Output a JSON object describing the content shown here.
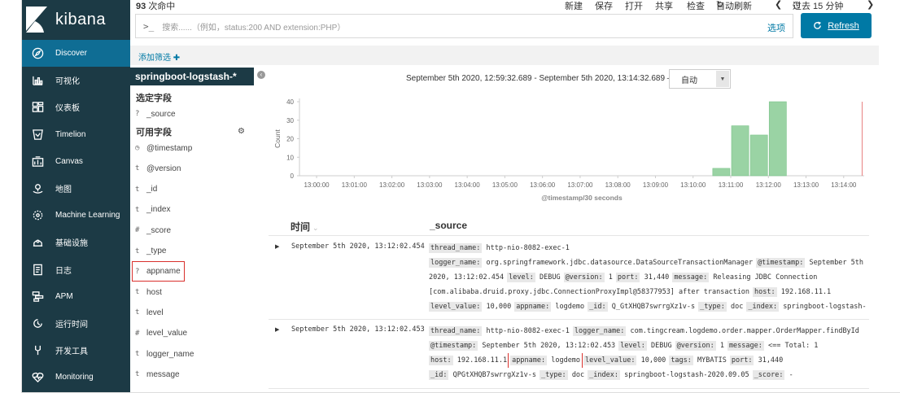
{
  "brand": {
    "name": "kibana"
  },
  "nav": {
    "items": [
      {
        "label": "Discover",
        "icon": "compass-icon",
        "active": true
      },
      {
        "label": "可视化",
        "icon": "visualize-icon"
      },
      {
        "label": "仪表板",
        "icon": "dashboard-icon"
      },
      {
        "label": "Timelion",
        "icon": "timelion-icon"
      },
      {
        "label": "Canvas",
        "icon": "canvas-icon"
      },
      {
        "label": "地图",
        "icon": "maps-icon"
      },
      {
        "label": "Machine Learning",
        "icon": "ml-icon"
      },
      {
        "label": "基础设施",
        "icon": "infra-icon"
      },
      {
        "label": "日志",
        "icon": "logs-icon"
      },
      {
        "label": "APM",
        "icon": "apm-icon"
      },
      {
        "label": "运行时间",
        "icon": "uptime-icon"
      },
      {
        "label": "开发工具",
        "icon": "devtools-icon"
      },
      {
        "label": "Monitoring",
        "icon": "monitoring-icon"
      }
    ]
  },
  "topbar": {
    "hits_count": "93",
    "hits_suffix": "次命中",
    "menu": {
      "new": "新建",
      "save": "保存",
      "open": "打开",
      "share": "共享",
      "inspect": "检查",
      "auto_refresh": "自动刷新",
      "time_range": "过去 15 分钟"
    },
    "search": {
      "prompt": ">_",
      "placeholder": "搜索......（例如，status:200 AND extension:PHP）",
      "options": "选项"
    },
    "refresh": "Refresh",
    "add_filter": "添加筛选"
  },
  "sidebar": {
    "index_pattern": "springboot-logstash-*",
    "selected_title": "选定字段",
    "selected_fields": [
      {
        "type": "?",
        "name": "_source"
      }
    ],
    "available_title": "可用字段",
    "available_fields": [
      {
        "type": "clock",
        "name": "@timestamp"
      },
      {
        "type": "t",
        "name": "@version"
      },
      {
        "type": "t",
        "name": "_id"
      },
      {
        "type": "t",
        "name": "_index"
      },
      {
        "type": "#",
        "name": "_score"
      },
      {
        "type": "t",
        "name": "_type"
      },
      {
        "type": "?",
        "name": "appname",
        "highlighted": true
      },
      {
        "type": "t",
        "name": "host"
      },
      {
        "type": "t",
        "name": "level"
      },
      {
        "type": "#",
        "name": "level_value"
      },
      {
        "type": "t",
        "name": "logger_name"
      },
      {
        "type": "t",
        "name": "message"
      }
    ]
  },
  "histogram": {
    "time_range_label": "September 5th 2020, 12:59:32.689 - September 5th 2020, 13:14:32.689 —",
    "interval": "自动"
  },
  "chart_data": {
    "type": "bar",
    "xlabel": "@timestamp/30 seconds",
    "ylabel": "Count",
    "ylim": [
      0,
      40
    ],
    "yticks": [
      0,
      10,
      20,
      30,
      40
    ],
    "xticks": [
      "13:00:00",
      "13:01:00",
      "13:02:00",
      "13:03:00",
      "13:04:00",
      "13:05:00",
      "13:06:00",
      "13:07:00",
      "13:08:00",
      "13:09:00",
      "13:10:00",
      "13:11:00",
      "13:12:00",
      "13:13:00",
      "13:14:00"
    ],
    "bars": [
      {
        "x": "13:10:30",
        "value": 4
      },
      {
        "x": "13:11:00",
        "value": 27
      },
      {
        "x": "13:11:30",
        "value": 22
      },
      {
        "x": "13:12:00",
        "value": 40
      }
    ],
    "bar_color": "#9ad3a4",
    "now_line": "13:14:32"
  },
  "table": {
    "col_time": "时间",
    "col_source": "_source",
    "rows": [
      {
        "time": "September 5th 2020, 13:12:02.454",
        "lines": [
          [
            [
              "thread_name:",
              "http-nio-8082-exec-1"
            ]
          ],
          [
            [
              "logger_name:",
              "org.springframework.jdbc.datasource.DataSourceTransactionManager"
            ],
            [
              "@timestamp:",
              "September 5th"
            ]
          ],
          [
            [
              "",
              "2020, 13:12:02.454"
            ],
            [
              "level:",
              "DEBUG"
            ],
            [
              "@version:",
              "1"
            ],
            [
              "port:",
              "31,440"
            ],
            [
              "message:",
              "Releasing JDBC Connection"
            ]
          ],
          [
            [
              "",
              "[com.alibaba.druid.proxy.jdbc.ConnectionProxyImpl@58377953] after transaction"
            ],
            [
              "host:",
              "192.168.11.1"
            ]
          ],
          [
            [
              "level_value:",
              "10,000"
            ],
            [
              "appname:",
              "logdemo"
            ],
            [
              "_id:",
              "Q_GtXHQB7swrrgXz1v-s"
            ],
            [
              "_type:",
              "doc"
            ],
            [
              "_index:",
              "springboot-logstash-"
            ]
          ]
        ]
      },
      {
        "time": "September 5th 2020, 13:12:02.453",
        "lines": [
          [
            [
              "thread_name:",
              "http-nio-8082-exec-1"
            ],
            [
              "logger_name:",
              "com.tingcream.logdemo.order.mapper.OrderMapper.findById"
            ]
          ],
          [
            [
              "@timestamp:",
              "September 5th 2020, 13:12:02.453"
            ],
            [
              "level:",
              "DEBUG"
            ],
            [
              "@version:",
              "1"
            ],
            [
              "message:",
              "<== Total: 1"
            ]
          ],
          [
            [
              "host:",
              "192.168.11.1"
            ],
            [
              "appname:",
              "logdemo"
            ],
            [
              "level_value:",
              "10,000"
            ],
            [
              "tags:",
              "MYBATIS"
            ],
            [
              "port:",
              "31,440"
            ]
          ],
          [
            [
              "_id:",
              "QPGtXHQB7swrrgXz1v-s"
            ],
            [
              "_type:",
              "doc"
            ],
            [
              "_index:",
              "springboot-logstash-2020.09.05"
            ],
            [
              "_score:",
              " -"
            ]
          ]
        ]
      }
    ]
  }
}
